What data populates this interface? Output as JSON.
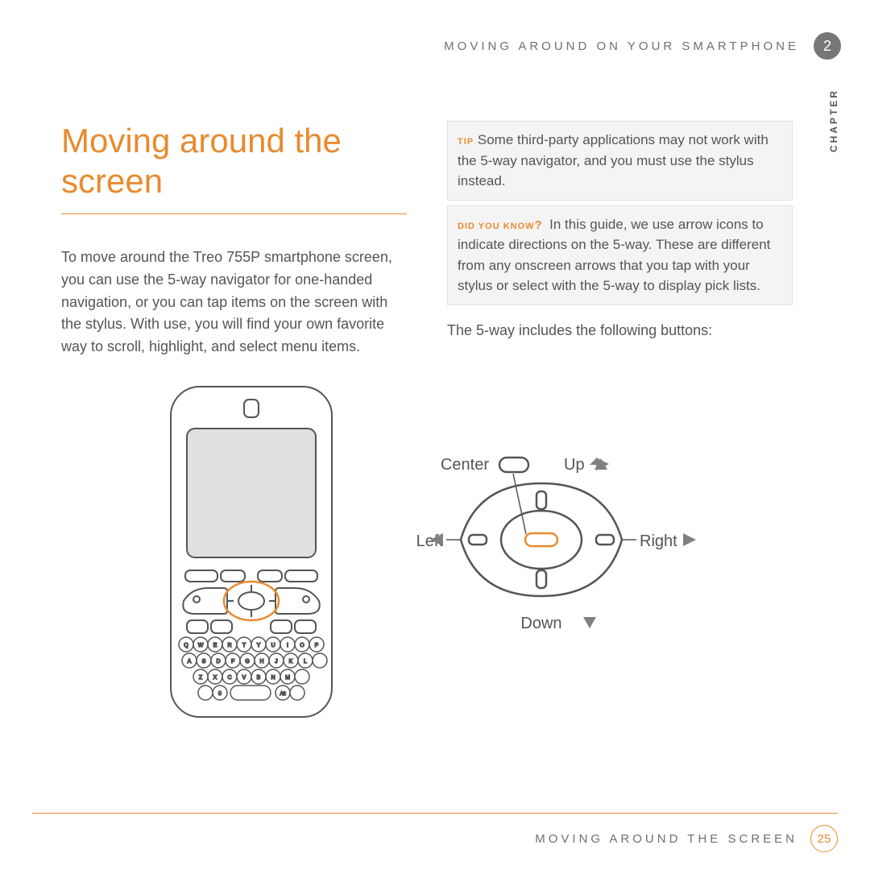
{
  "header": {
    "running_title": "MOVING AROUND ON YOUR SMARTPHONE",
    "chapter_number": "2",
    "side_label": "CHAPTER"
  },
  "left_column": {
    "heading": "Moving around the screen",
    "body": "To move around the Treo 755P smartphone screen, you can use the 5-way navigator for one-handed navigation, or you can tap items on the screen with the stylus. With use, you will find your own favorite way to scroll, highlight, and select menu items."
  },
  "right_column": {
    "tip_tag": "TIP",
    "tip_text": "Some third-party applications may not work with the 5-way navigator, and you must use the stylus instead.",
    "dyk_tag": "DID YOU KNOW",
    "dyk_q": "?",
    "dyk_text": "In this guide, we use arrow icons to indicate directions on the 5-way. These are different from any onscreen arrows that you tap with your stylus or select with the 5-way to display pick lists.",
    "lead": "The 5-way includes the following buttons:"
  },
  "diagram": {
    "center": "Center",
    "up": "Up",
    "left": "Left",
    "right": "Right",
    "down": "Down"
  },
  "footer": {
    "section": "MOVING AROUND THE SCREEN",
    "page": "25"
  }
}
